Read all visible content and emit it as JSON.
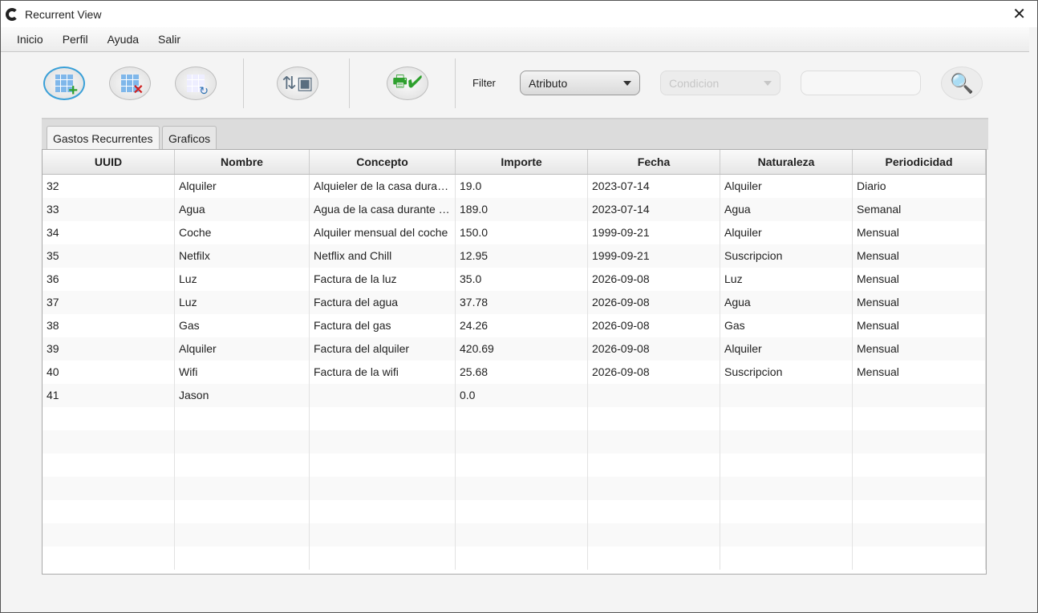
{
  "window": {
    "title": "Recurrent View"
  },
  "menu": [
    "Inicio",
    "Perfil",
    "Ayuda",
    "Salir"
  ],
  "toolbar": {
    "filter_label": "Filter",
    "atributo": "Atributo",
    "condicion": "Condicion",
    "filter_value": ""
  },
  "tabs": [
    "Gastos Recurrentes",
    "Graficos"
  ],
  "table": {
    "columns": [
      "UUID",
      "Nombre",
      "Concepto",
      "Importe",
      "Fecha",
      "Naturaleza",
      "Periodicidad"
    ],
    "rows": [
      [
        "32",
        "Alquiler",
        "Alquieler de la casa durante el mes",
        "19.0",
        "2023-07-14",
        "Alquiler",
        "Diario"
      ],
      [
        "33",
        "Agua",
        "Agua de la casa durante el mes",
        "189.0",
        "2023-07-14",
        "Agua",
        "Semanal"
      ],
      [
        "34",
        "Coche",
        "Alquiler mensual del coche",
        "150.0",
        "1999-09-21",
        "Alquiler",
        "Mensual"
      ],
      [
        "35",
        "Netfilx",
        "Netflix and Chill",
        "12.95",
        "1999-09-21",
        "Suscripcion",
        "Mensual"
      ],
      [
        "36",
        "Luz",
        "Factura de la luz",
        "35.0",
        "2026-09-08",
        "Luz",
        "Mensual"
      ],
      [
        "37",
        "Luz",
        "Factura del agua",
        "37.78",
        "2026-09-08",
        "Agua",
        "Mensual"
      ],
      [
        "38",
        "Gas",
        "Factura del gas",
        "24.26",
        "2026-09-08",
        "Gas",
        "Mensual"
      ],
      [
        "39",
        "Alquiler",
        "Factura del alquiler",
        "420.69",
        "2026-09-08",
        "Alquiler",
        "Mensual"
      ],
      [
        "40",
        "Wifi",
        "Factura de la wifi",
        "25.68",
        "2026-09-08",
        "Suscripcion",
        "Mensual"
      ],
      [
        "41",
        "Jason",
        "",
        "0.0",
        "",
        "",
        ""
      ]
    ]
  }
}
